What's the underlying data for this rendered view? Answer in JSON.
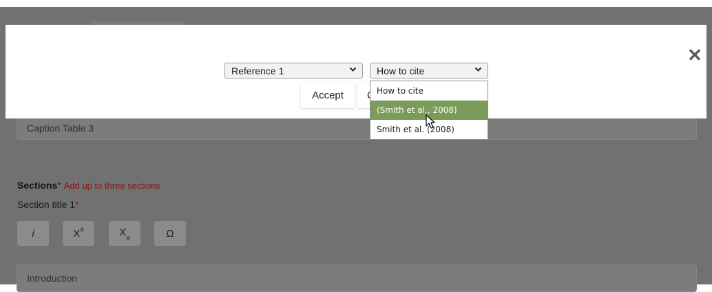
{
  "background": {
    "caption_field_value": "Caption Table 3",
    "sections_label": "Sections",
    "required_star": "*",
    "sections_note": "Add up to three sections",
    "section_title_label": "Section title 1",
    "format_buttons": {
      "italic": "i",
      "superscript_base": "X",
      "superscript_mark": "a",
      "subscript_base": "X",
      "subscript_mark": "a",
      "special_char": "Ω"
    },
    "intro_field_value": "Introduction"
  },
  "modal": {
    "close_glyph": "✕",
    "reference_select_value": "Reference 1",
    "cite_select_value": "How to cite",
    "accept_label": "Accept",
    "cancel_label_visible": "C",
    "cite_options": [
      "How to cite",
      "(Smith et al., 2008)",
      "Smith et al. (2008)"
    ],
    "highlighted_option_index": 1
  },
  "colors": {
    "overlay": "#717171",
    "highlight": "#7a9b5a",
    "required": "#8a1414"
  }
}
